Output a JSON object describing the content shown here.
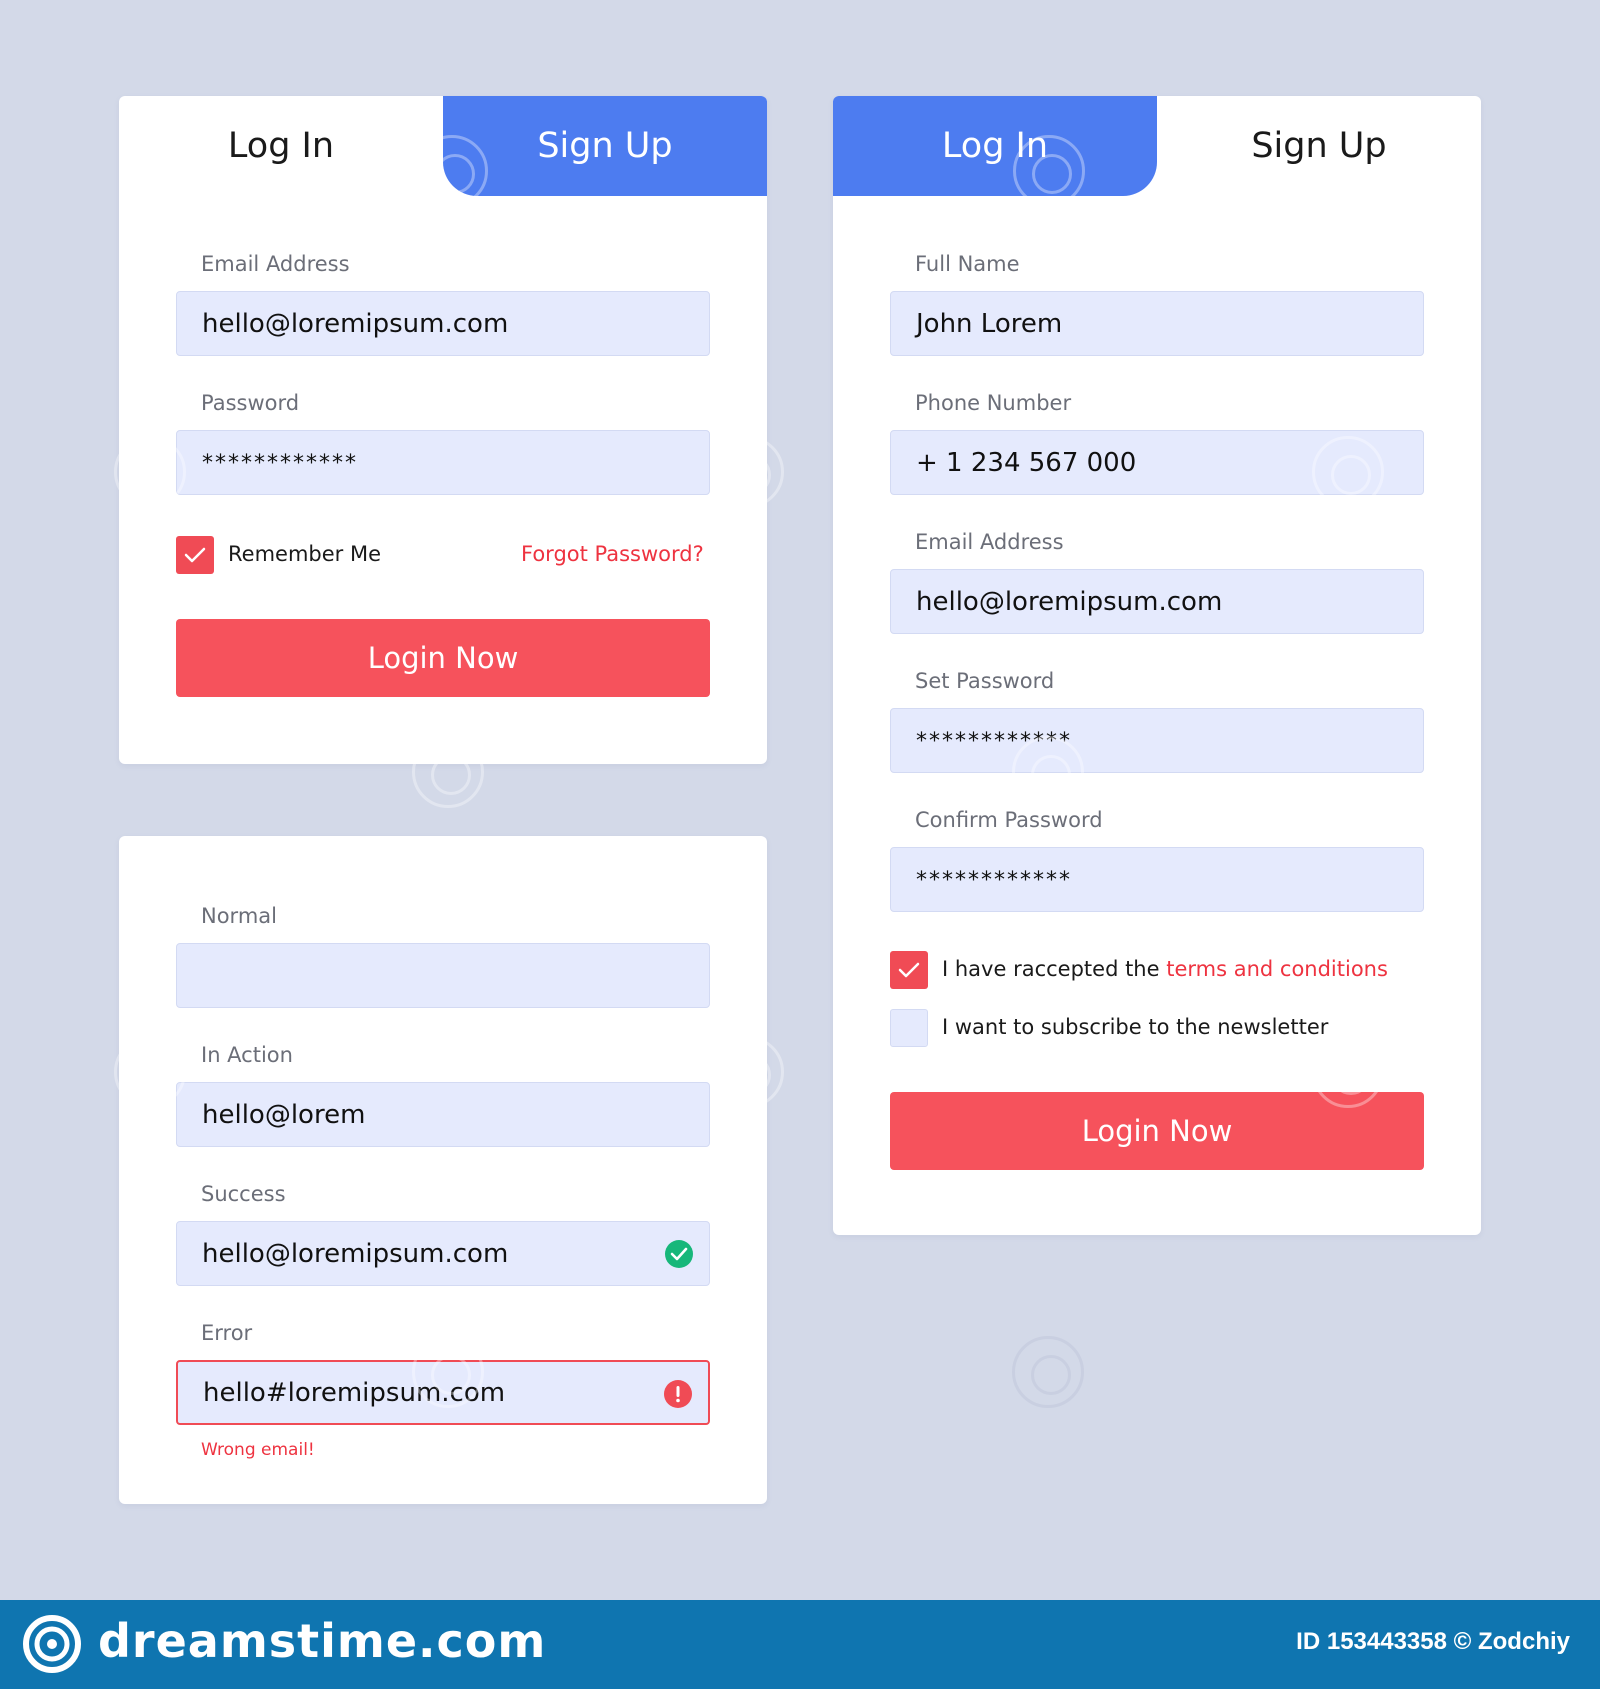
{
  "login_card": {
    "tabs": {
      "login": "Log In",
      "signup": "Sign Up",
      "active": "signup"
    },
    "email": {
      "label": "Email Address",
      "value": "hello@loremipsum.com"
    },
    "password": {
      "label": "Password",
      "value": "************"
    },
    "remember": {
      "label": "Remember Me",
      "checked": true
    },
    "forgot_link": "Forgot Password?",
    "submit_label": "Login Now"
  },
  "states_card": {
    "normal": {
      "label": "Normal",
      "value": ""
    },
    "in_action": {
      "label": "In Action",
      "value": "hello@lorem"
    },
    "success": {
      "label": "Success",
      "value": "hello@loremipsum.com",
      "icon": "check-circle-icon"
    },
    "error": {
      "label": "Error",
      "value": "hello#loremipsum.com",
      "icon": "exclamation-circle-icon",
      "message": "Wrong email!"
    }
  },
  "signup_card": {
    "tabs": {
      "login": "Log In",
      "signup": "Sign Up",
      "active": "login"
    },
    "full_name": {
      "label": "Full Name",
      "value": "John Lorem"
    },
    "phone": {
      "label": "Phone Number",
      "value": "+ 1 234 567 000"
    },
    "email": {
      "label": "Email Address",
      "value": "hello@loremipsum.com"
    },
    "set_password": {
      "label": "Set Password",
      "value": "************"
    },
    "confirm_password": {
      "label": "Confirm Password",
      "value": "************"
    },
    "terms": {
      "prefix": "I have raccepted the ",
      "link": "terms and conditions",
      "checked": true
    },
    "newsletter": {
      "label": "I want to subscribe to the newsletter",
      "checked": false
    },
    "submit_label": "Login Now"
  },
  "footer": {
    "brand": "dreamstime.com",
    "id_text": "ID 153443358 © Zodchiy"
  },
  "colors": {
    "background": "#d3d9e8",
    "tab_active": "#4d7cf0",
    "accent_red": "#f6525c",
    "input_bg": "#e5eafd",
    "success_green": "#17b77a",
    "footer_bg": "#0f75b0"
  }
}
